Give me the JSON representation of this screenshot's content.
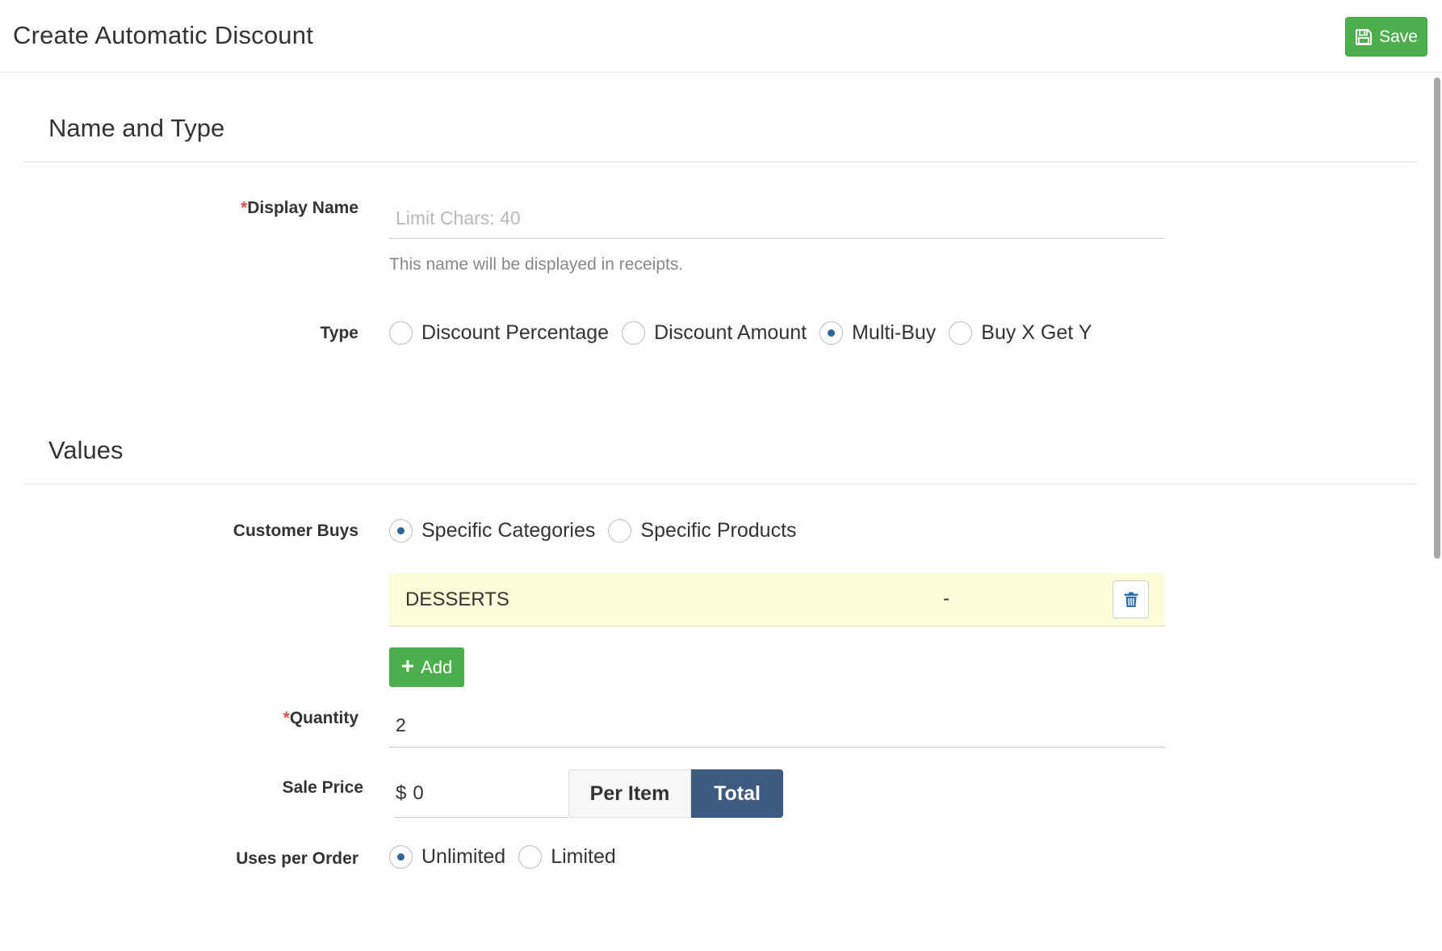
{
  "header": {
    "title": "Create Automatic Discount",
    "save_label": "Save"
  },
  "sections": {
    "name_type": {
      "title": "Name and Type"
    },
    "values": {
      "title": "Values"
    }
  },
  "display_name": {
    "required_mark": "*",
    "label": "Display Name",
    "placeholder": "Limit Chars: 40",
    "value": "",
    "help": "This name will be displayed in receipts."
  },
  "type": {
    "label": "Type",
    "options": [
      "Discount Percentage",
      "Discount Amount",
      "Multi-Buy",
      "Buy X Get Y"
    ],
    "selected": "Multi-Buy"
  },
  "customer_buys": {
    "label": "Customer Buys",
    "options": [
      "Specific Categories",
      "Specific Products"
    ],
    "selected": "Specific Categories",
    "items": [
      {
        "name": "DESSERTS",
        "detail": "-"
      }
    ],
    "add_label": "Add"
  },
  "quantity": {
    "required_mark": "*",
    "label": "Quantity",
    "value": "2"
  },
  "sale_price": {
    "label": "Sale Price",
    "currency": "$",
    "value": "0",
    "modes": [
      "Per Item",
      "Total"
    ],
    "selected_mode": "Total"
  },
  "uses_per_order": {
    "label": "Uses per Order",
    "options": [
      "Unlimited",
      "Limited"
    ],
    "selected": "Unlimited"
  },
  "colors": {
    "primary_green": "#4cae4c",
    "selected_toggle": "#3d5a80",
    "row_highlight": "#fdfdd9",
    "required": "#d9534f"
  }
}
